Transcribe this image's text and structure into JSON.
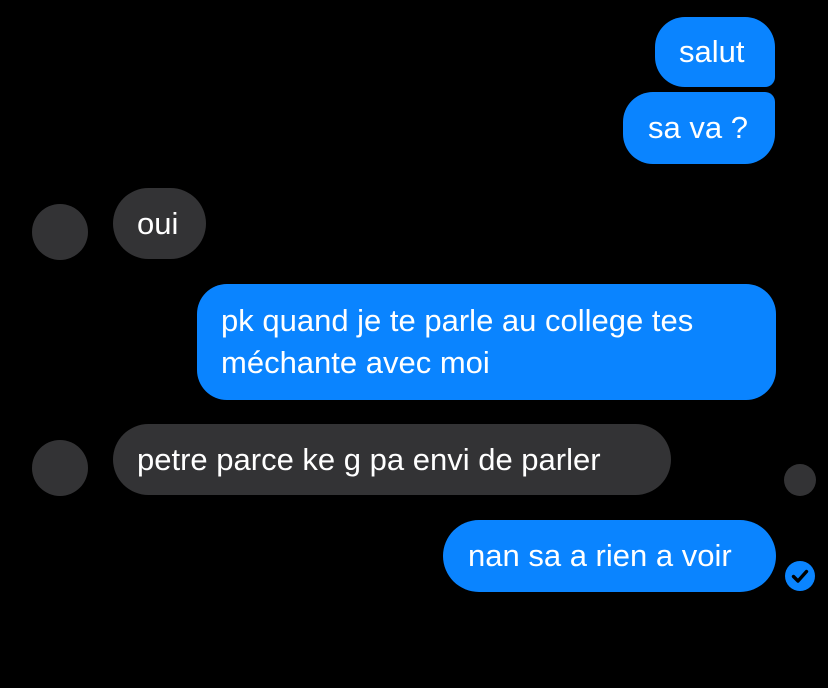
{
  "messages": [
    {
      "id": "m1",
      "direction": "outgoing",
      "text": "salut"
    },
    {
      "id": "m2",
      "direction": "outgoing",
      "text": "sa va ?"
    },
    {
      "id": "m3",
      "direction": "incoming",
      "text": "oui"
    },
    {
      "id": "m4",
      "direction": "outgoing",
      "lines": [
        "pk quand je te parle au college tes",
        "méchante avec moi"
      ]
    },
    {
      "id": "m5",
      "direction": "incoming",
      "text": "petre parce ke g pa envi de parler"
    },
    {
      "id": "m6",
      "direction": "outgoing",
      "text": "nan sa a rien a voir"
    }
  ],
  "status": {
    "delivered_icon": "check-circle-icon",
    "seen_avatar_icon": "avatar-circle"
  },
  "colors": {
    "background": "#000000",
    "outgoing_bubble": "#0a84ff",
    "incoming_bubble": "#333335",
    "text": "#ffffff"
  }
}
